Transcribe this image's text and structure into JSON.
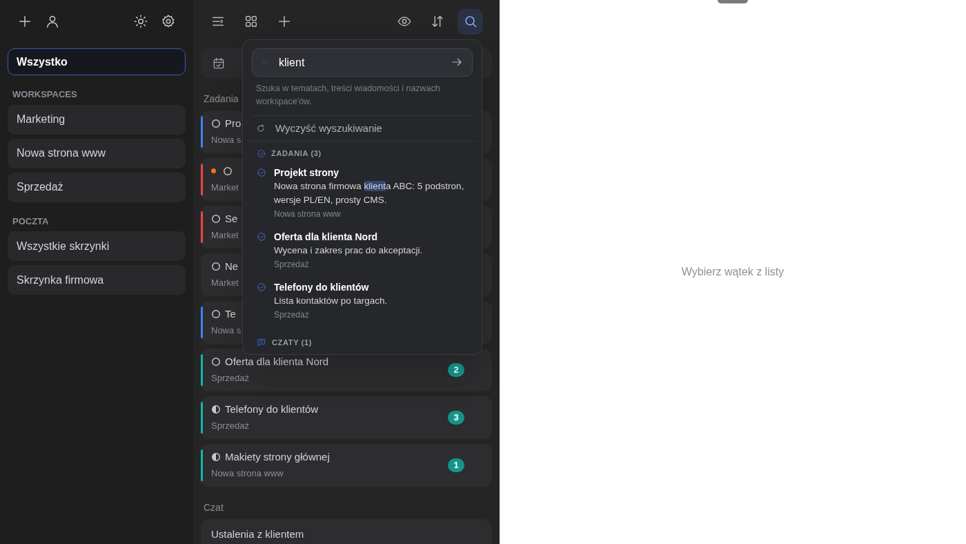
{
  "sidebar": {
    "all_item": {
      "label": "Wszystko",
      "selected": true
    },
    "sections": [
      {
        "title": "WORKSPACES",
        "items": [
          {
            "label": "Marketing",
            "selected": false
          },
          {
            "label": "Nowa strona www",
            "selected": false
          },
          {
            "label": "Sprzedaż",
            "selected": false
          }
        ]
      },
      {
        "title": "POCZTA",
        "items": [
          {
            "label": "Wszystkie skrzynki",
            "selected": false
          },
          {
            "label": "Skrzynka firmowa",
            "selected": false
          }
        ]
      }
    ]
  },
  "list": {
    "toolbar": [
      {
        "selected": false
      },
      {
        "selected": false
      },
      {
        "selected": false
      },
      {
        "selected": false
      },
      {
        "selected": false
      },
      {
        "selected": true
      }
    ],
    "sections": [
      {
        "title": "Zadania",
        "tasks": [
          {
            "title": "Pro",
            "subtitle": "Nowa s",
            "color": "#3b82f6",
            "kind": "open",
            "dot": false
          },
          {
            "subtitle": "Market",
            "color": "#ef4444",
            "kind": "open",
            "dot": true
          },
          {
            "title": "Se",
            "subtitle": "Market",
            "color": "#ef4444",
            "kind": "open",
            "dot": false
          },
          {
            "title": "Ne",
            "subtitle": "Market",
            "kind": "open",
            "dot": false
          },
          {
            "title": "Te",
            "subtitle": "Nowa s",
            "color": "#3b82f6",
            "kind": "open",
            "dot": false
          },
          {
            "title": "Oferta dla klienta Nord",
            "subtitle": "Sprzedaż",
            "color": "#14b8a6",
            "kind": "open",
            "dot": false,
            "badge": "2"
          },
          {
            "title": "Telefony do klientów",
            "subtitle": "Sprzedaż",
            "color": "#14b8a6",
            "kind": "half",
            "dot": false,
            "badge": "3"
          },
          {
            "title": "Makiety strony głównej",
            "subtitle": "Nowa strona www",
            "color": "#14b8a6",
            "kind": "half",
            "dot": false,
            "badge": "1"
          }
        ]
      },
      {
        "title": "Czat",
        "chats": [
          {
            "title": "Ustalenia z klientem"
          }
        ]
      }
    ]
  },
  "search_popover": {
    "query": "klient",
    "hint": "Szuka w tematach, treści wiadomości i nazwach workspace'ów.",
    "clear_label": "Wyczyść wyszukiwanie",
    "groups": [
      {
        "kind": "tasks",
        "title": "ZADANIA (3)",
        "results": [
          {
            "title": "Projekt strony",
            "description": [
              {
                "text": "Nowa strona firmowa ",
                "highlight": false
              },
              {
                "text": "klient",
                "highlight": true
              },
              {
                "text": "a ABC: 5 podstron, wersje PL/EN, prosty CMS.",
                "highlight": false
              }
            ],
            "workspace": "Nowa strona www"
          },
          {
            "title": "Oferta dla klienta Nord",
            "description": [
              {
                "text": "Wycena i zakres prac do akceptacji.",
                "highlight": false
              }
            ],
            "workspace": "Sprzedaż"
          },
          {
            "title": "Telefony do klientów",
            "description": [
              {
                "text": "Lista kontaktów po targach.",
                "highlight": false
              }
            ],
            "workspace": "Sprzedaż"
          }
        ]
      },
      {
        "kind": "chats",
        "title": "CZATY (1)"
      }
    ]
  },
  "detail": {
    "empty_text": "Wybierz wątek z listy"
  }
}
